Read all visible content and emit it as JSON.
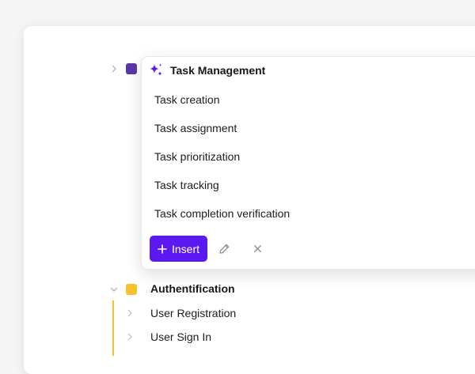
{
  "tree": {
    "items": [
      {
        "label": "Task Management",
        "color": "#5a37a8",
        "expanded": false
      },
      {
        "label": "Authentification",
        "color": "#f6c22a",
        "expanded": true,
        "children": [
          {
            "label": "User Registration"
          },
          {
            "label": "User Sign In"
          }
        ]
      }
    ]
  },
  "popup": {
    "title": "Task Management",
    "icon": "sparkle-icon",
    "suggestions": [
      "Task creation",
      "Task assignment",
      "Task prioritization",
      "Task tracking",
      "Task completion verification"
    ],
    "insert_label": "Insert",
    "accent": "#5b18f0"
  }
}
